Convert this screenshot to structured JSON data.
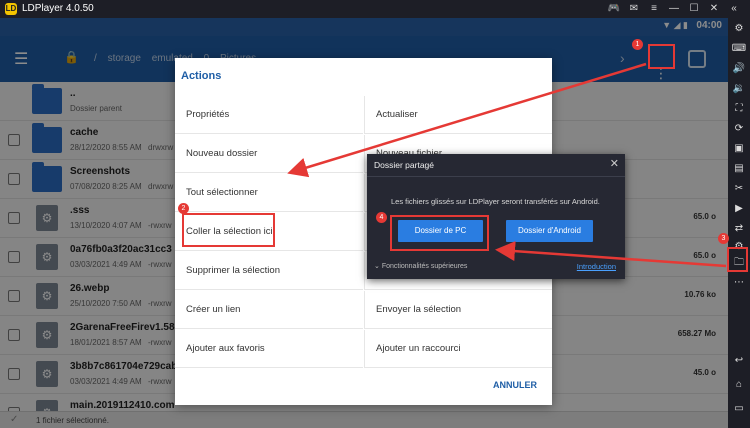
{
  "titlebar": {
    "title": "LDPlayer 4.0.50",
    "logo": "LD"
  },
  "statusbar": {
    "clock": "04:00"
  },
  "appbar": {
    "crumbs": [
      "/",
      "storage",
      "emulated",
      "0",
      "Pictures"
    ]
  },
  "files": [
    {
      "name": "..",
      "meta": "Dossier parent",
      "perm": "",
      "size": "",
      "type": "folder",
      "checkbox": false
    },
    {
      "name": "cache",
      "meta": "28/12/2020 8:55 AM",
      "perm": "drwxrw",
      "size": "",
      "type": "folder",
      "checkbox": true
    },
    {
      "name": "Screenshots",
      "meta": "07/08/2020 8:25 AM",
      "perm": "drwxrw",
      "size": "",
      "type": "folder",
      "checkbox": true
    },
    {
      "name": ".sss",
      "meta": "13/10/2020 4:07 AM",
      "perm": "-rwxrw",
      "size": "65.0 o",
      "type": "file",
      "checkbox": true
    },
    {
      "name": "0a76fb0a3f20ac31cc3",
      "meta": "03/03/2021 4:49 AM",
      "perm": "-rwxrw",
      "size": "65.0 o",
      "type": "file",
      "checkbox": true
    },
    {
      "name": "26.webp",
      "meta": "25/10/2020 7:50 AM",
      "perm": "-rwxrw",
      "size": "10.76 ko",
      "type": "file",
      "checkbox": true
    },
    {
      "name": "2GarenaFreeFirev1.58.3",
      "meta": "18/01/2021 8:57 AM",
      "perm": "-rwxrw",
      "size": "658.27 Mo",
      "type": "file",
      "checkbox": true
    },
    {
      "name": "3b8b7c861704e729cabb",
      "meta": "03/03/2021 4:49 AM",
      "perm": "-rwxrw",
      "size": "45.0 o",
      "type": "file",
      "checkbox": true
    },
    {
      "name": "main.2019112410.com",
      "meta": "",
      "perm": "",
      "size": "",
      "type": "file",
      "checkbox": true
    }
  ],
  "bottombar": {
    "text": "1 fichier sélectionné."
  },
  "actions": {
    "title": "Actions",
    "items_left": [
      "Propriétés",
      "Nouveau dossier",
      "Tout sélectionner",
      "Coller la sélection ici",
      "Supprimer la sélection",
      "Créer un lien",
      "Ajouter aux favoris"
    ],
    "items_right": [
      "Actualiser",
      "Nouveau fichier",
      "",
      "",
      "",
      "Envoyer la sélection",
      "Ajouter un raccourci"
    ],
    "cancel": "ANNULER"
  },
  "shared": {
    "title": "Dossier partagé",
    "message": "Les fichiers glissés sur LDPlayer seront transférés sur Android.",
    "pc_button": "Dossier de PC",
    "android_button": "Dossier d'Android",
    "advanced": "Fonctionnalités supérieures",
    "intro": "Introduction"
  },
  "badges": [
    "1",
    "2",
    "3",
    "4"
  ],
  "colors": {
    "accent": "#1f5ea6",
    "highlight": "#e53935",
    "button": "#2a7de1"
  }
}
